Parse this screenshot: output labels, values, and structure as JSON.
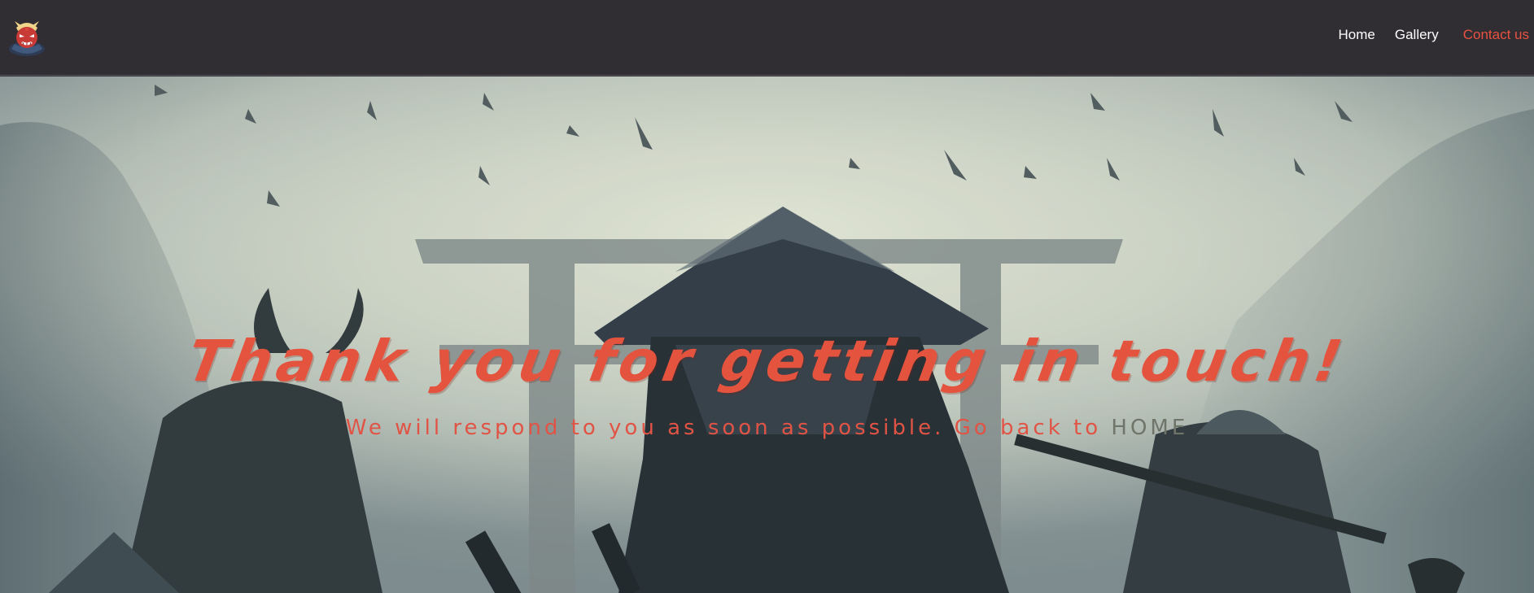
{
  "header": {
    "logo_icon": "samurai-mask-logo-icon",
    "nav": [
      {
        "label": "Home",
        "active": false
      },
      {
        "label": "Gallery",
        "active": false
      },
      {
        "label": "Contact us",
        "active": true
      }
    ]
  },
  "hero": {
    "headline": "Thank you for getting in touch!",
    "message": "We will respond to you as soon as possible. Go back to",
    "home_link": "HOME",
    "background_image": "samurai-warriors-torii-gate-image"
  },
  "colors": {
    "navbar_bg": "#302d33",
    "accent": "#e8523f",
    "nav_text": "#ffffff",
    "home_link": "#6f7568"
  }
}
